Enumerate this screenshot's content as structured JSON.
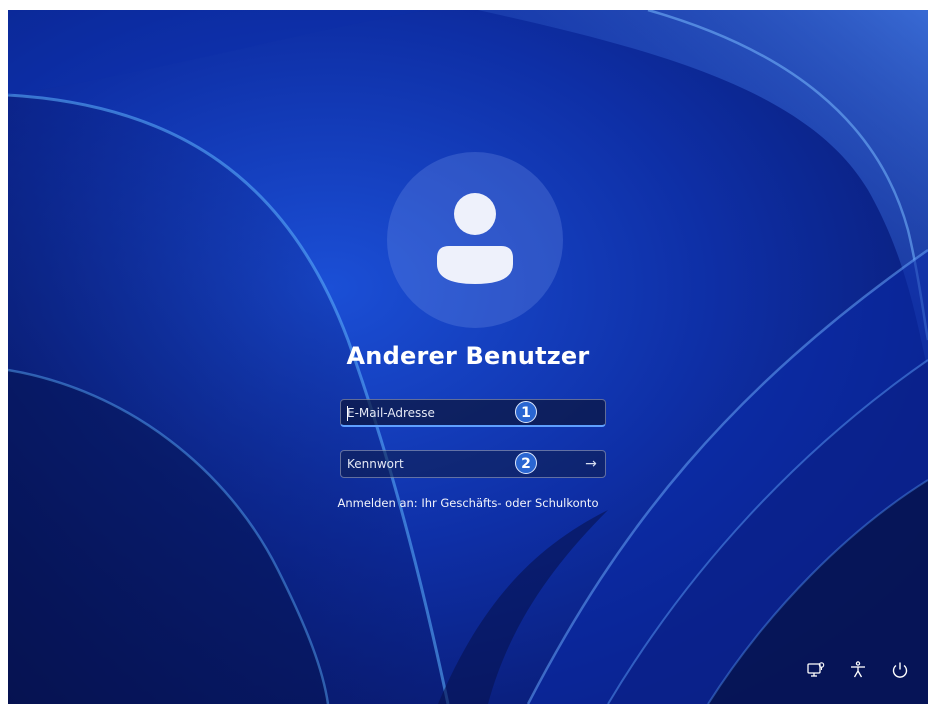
{
  "user": {
    "name": "Anderer Benutzer",
    "avatar_icon": "user-silhouette-icon"
  },
  "email_field": {
    "placeholder": "E-Mail-Adresse",
    "value": "",
    "callout": "1"
  },
  "password_field": {
    "placeholder": "Kennwort",
    "value": "",
    "callout": "2",
    "submit_icon": "arrow-right-icon",
    "submit_glyph": "→"
  },
  "sign_in_hint": "Anmelden an: Ihr Geschäfts- oder Schulkonto",
  "system_icons": [
    {
      "name": "network-icon"
    },
    {
      "name": "accessibility-icon"
    },
    {
      "name": "power-icon"
    }
  ],
  "colors": {
    "accent": "#5fa0ff",
    "callout": "#2a66d2",
    "background_dark": "#0a1f7d",
    "text": "#ffffff"
  }
}
